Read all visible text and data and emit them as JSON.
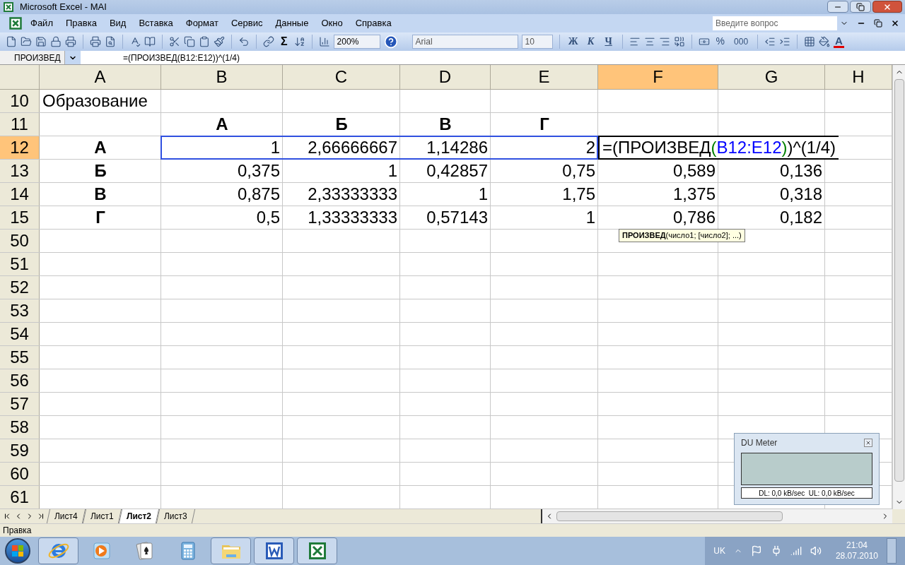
{
  "window": {
    "title": "Microsoft Excel - MAI"
  },
  "menu": [
    "Файл",
    "Правка",
    "Вид",
    "Вставка",
    "Формат",
    "Сервис",
    "Данные",
    "Окно",
    "Справка"
  ],
  "help_search": {
    "placeholder": "Введите вопрос"
  },
  "toolbar": {
    "autosum": "Σ",
    "zoom": "200%",
    "font": "Arial",
    "font_size": "10",
    "format_buttons": [
      "Ж",
      "К",
      "Ч"
    ],
    "percent": "%",
    "thousands": "000",
    "font_color": "A"
  },
  "formula_bar": {
    "name_box": "ПРОИЗВЕД",
    "formula": "=(ПРОИЗВЕД(B12:E12))^(1/4)"
  },
  "columns": [
    {
      "label": "A",
      "selected": false
    },
    {
      "label": "B",
      "selected": false
    },
    {
      "label": "C",
      "selected": false
    },
    {
      "label": "D",
      "selected": false
    },
    {
      "label": "E",
      "selected": false
    },
    {
      "label": "F",
      "selected": true
    },
    {
      "label": "G",
      "selected": false
    },
    {
      "label": "H",
      "selected": false
    }
  ],
  "rows": [
    {
      "label": "10",
      "selected": false,
      "cells": [
        {
          "kind": "text",
          "text": "Образование"
        },
        null,
        null,
        null,
        null,
        null,
        null,
        null
      ]
    },
    {
      "label": "11",
      "selected": false,
      "cells": [
        null,
        {
          "kind": "label",
          "text": "А"
        },
        {
          "kind": "label",
          "text": "Б"
        },
        {
          "kind": "label",
          "text": "В"
        },
        {
          "kind": "label",
          "text": "Г"
        },
        null,
        null,
        null
      ]
    },
    {
      "label": "12",
      "selected": true,
      "cells": [
        {
          "kind": "label",
          "text": "А"
        },
        {
          "kind": "number",
          "text": "1",
          "in_range": true
        },
        {
          "kind": "number",
          "text": "2,66666667",
          "in_range": true
        },
        {
          "kind": "number",
          "text": "1,14286",
          "in_range": true
        },
        {
          "kind": "number",
          "text": "2",
          "in_range": true
        },
        {
          "kind": "formula",
          "parts": [
            {
              "text": "=(ПРОИЗВЕД",
              "color": "#000000"
            },
            {
              "text": "(",
              "color": "#008000"
            },
            {
              "text": "B12:E12",
              "color": "#0000ff"
            },
            {
              "text": ")",
              "color": "#008000"
            },
            {
              "text": ")^(1/4)",
              "color": "#000000"
            }
          ]
        },
        null,
        null
      ]
    },
    {
      "label": "13",
      "selected": false,
      "cells": [
        {
          "kind": "label",
          "text": "Б"
        },
        {
          "kind": "number",
          "text": "0,375"
        },
        {
          "kind": "number",
          "text": "1"
        },
        {
          "kind": "number",
          "text": "0,42857"
        },
        {
          "kind": "number",
          "text": "0,75"
        },
        {
          "kind": "number",
          "text": "0,589"
        },
        {
          "kind": "number",
          "text": "0,136"
        },
        null
      ]
    },
    {
      "label": "14",
      "selected": false,
      "cells": [
        {
          "kind": "label",
          "text": "В"
        },
        {
          "kind": "number",
          "text": "0,875"
        },
        {
          "kind": "number",
          "text": "2,33333333"
        },
        {
          "kind": "number",
          "text": "1"
        },
        {
          "kind": "number",
          "text": "1,75"
        },
        {
          "kind": "number",
          "text": "1,375"
        },
        {
          "kind": "number",
          "text": "0,318"
        },
        null
      ]
    },
    {
      "label": "15",
      "selected": false,
      "cells": [
        {
          "kind": "label",
          "text": "Г"
        },
        {
          "kind": "number",
          "text": "0,5"
        },
        {
          "kind": "number",
          "text": "1,33333333"
        },
        {
          "kind": "number",
          "text": "0,57143"
        },
        {
          "kind": "number",
          "text": "1"
        },
        {
          "kind": "number",
          "text": "0,786"
        },
        {
          "kind": "number",
          "text": "0,182"
        },
        null
      ]
    },
    {
      "label": "50",
      "selected": false
    },
    {
      "label": "51",
      "selected": false
    },
    {
      "label": "52",
      "selected": false
    },
    {
      "label": "53",
      "selected": false
    },
    {
      "label": "54",
      "selected": false
    },
    {
      "label": "55",
      "selected": false
    },
    {
      "label": "56",
      "selected": false
    },
    {
      "label": "57",
      "selected": false
    },
    {
      "label": "58",
      "selected": false
    },
    {
      "label": "59",
      "selected": false
    },
    {
      "label": "60",
      "selected": false
    },
    {
      "label": "61",
      "selected": false
    }
  ],
  "tooltip": "**ПРОИЗВЕД**(число1; [число2]; ...)",
  "sheet_tabs": [
    {
      "label": "Лист4",
      "selected": false
    },
    {
      "label": "Лист1",
      "selected": false
    },
    {
      "label": "Лист2",
      "selected": true
    },
    {
      "label": "Лист3",
      "selected": false
    }
  ],
  "status": "Правка",
  "du_meter": {
    "title": "DU Meter",
    "reading": "DL: 0,0 kB/sec  UL: 0,0 kB/sec"
  },
  "taskbar": [
    {
      "kind": "browser",
      "open": true
    },
    {
      "kind": "media",
      "open": false
    },
    {
      "kind": "cards",
      "open": false
    },
    {
      "kind": "calculator",
      "open": false
    },
    {
      "kind": "folder",
      "open": true
    },
    {
      "kind": "document",
      "open": true
    },
    {
      "kind": "spreadsheet",
      "open": true
    }
  ],
  "tray": {
    "language": "UK",
    "time": "21:04",
    "date": "28.07.2010"
  }
}
